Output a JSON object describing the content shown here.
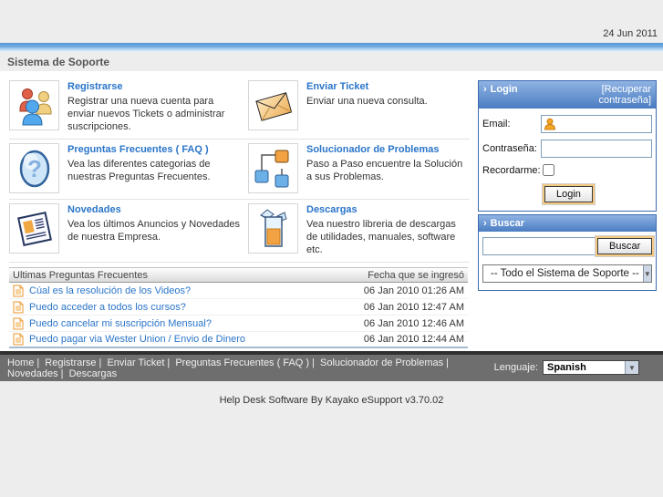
{
  "header": {
    "date": "24 Jun 2011",
    "title": "Sistema de Soporte"
  },
  "sections": [
    {
      "icon": "users-icon",
      "title": "Registrarse",
      "description": "Registrar una nueva cuenta para enviar nuevos Tickets o administrar suscripciones."
    },
    {
      "icon": "envelope-icon",
      "title": "Enviar Ticket",
      "description": "Enviar una nueva consulta."
    },
    {
      "icon": "question-icon",
      "title": "Preguntas Frecuentes ( FAQ )",
      "description": "Vea las diferentes categorias de nuestras Preguntas Frecuentes."
    },
    {
      "icon": "flowchart-icon",
      "title": "Solucionador de Problemas",
      "description": "Paso a Paso encuentre la Solución a sus Problemas."
    },
    {
      "icon": "news-icon",
      "title": "Novedades",
      "description": "Vea los últimos Anuncios y Novedades de nuestra Empresa."
    },
    {
      "icon": "downloads-box-icon",
      "title": "Descargas",
      "description": "Vea nuestro libreria de descargas de utilidades, manuales, software etc."
    }
  ],
  "faq_table": {
    "title": "Ultimas Preguntas Frecuentes",
    "date_header": "Fecha que se ingresó",
    "rows": [
      {
        "question": "Cúal es la resolución de los Videos?",
        "date": "06 Jan 2010 01:26 AM"
      },
      {
        "question": "Puedo acceder a todos los cursos?",
        "date": "06 Jan 2010 12:47 AM"
      },
      {
        "question": "Puedo cancelar mi suscripción Mensual?",
        "date": "06 Jan 2010 12:46 AM"
      },
      {
        "question": "Puedo pagar via Wester Union / Envio de Dinero",
        "date": "06 Jan 2010 12:44 AM"
      }
    ]
  },
  "login_box": {
    "arrow": "›",
    "title": "Login",
    "recover": "[Recuperar contraseña]",
    "email_label": "Email:",
    "email_value": "",
    "password_label": "Contraseña:",
    "password_value": "",
    "remember_label": "Recordarme:",
    "button": "Login"
  },
  "search_box": {
    "arrow": "›",
    "title": "Buscar",
    "input_value": "",
    "button": "Buscar",
    "scope": "-- Todo el Sistema de Soporte --"
  },
  "footer": {
    "links": [
      "Home",
      "Registrarse",
      "Enviar Ticket",
      "Preguntas Frecuentes ( FAQ )",
      "Solucionador de Problemas",
      "Novedades",
      "Descargas"
    ],
    "separator": "|",
    "language_label": "Lenguaje:",
    "language": "Spanish"
  },
  "credits": "Help Desk Software By Kayako eSupport v3.70.02",
  "colors": {
    "page_background": "#ededed",
    "content_background": "#ffffff",
    "blue_bar": "#549ad8",
    "box_header_blue": "#4a7cc2",
    "link_blue": "#2a75c9",
    "button_ring_orange": "#f3c984",
    "footer_gray": "#6e6e6e",
    "footer_strip": "#303030"
  }
}
